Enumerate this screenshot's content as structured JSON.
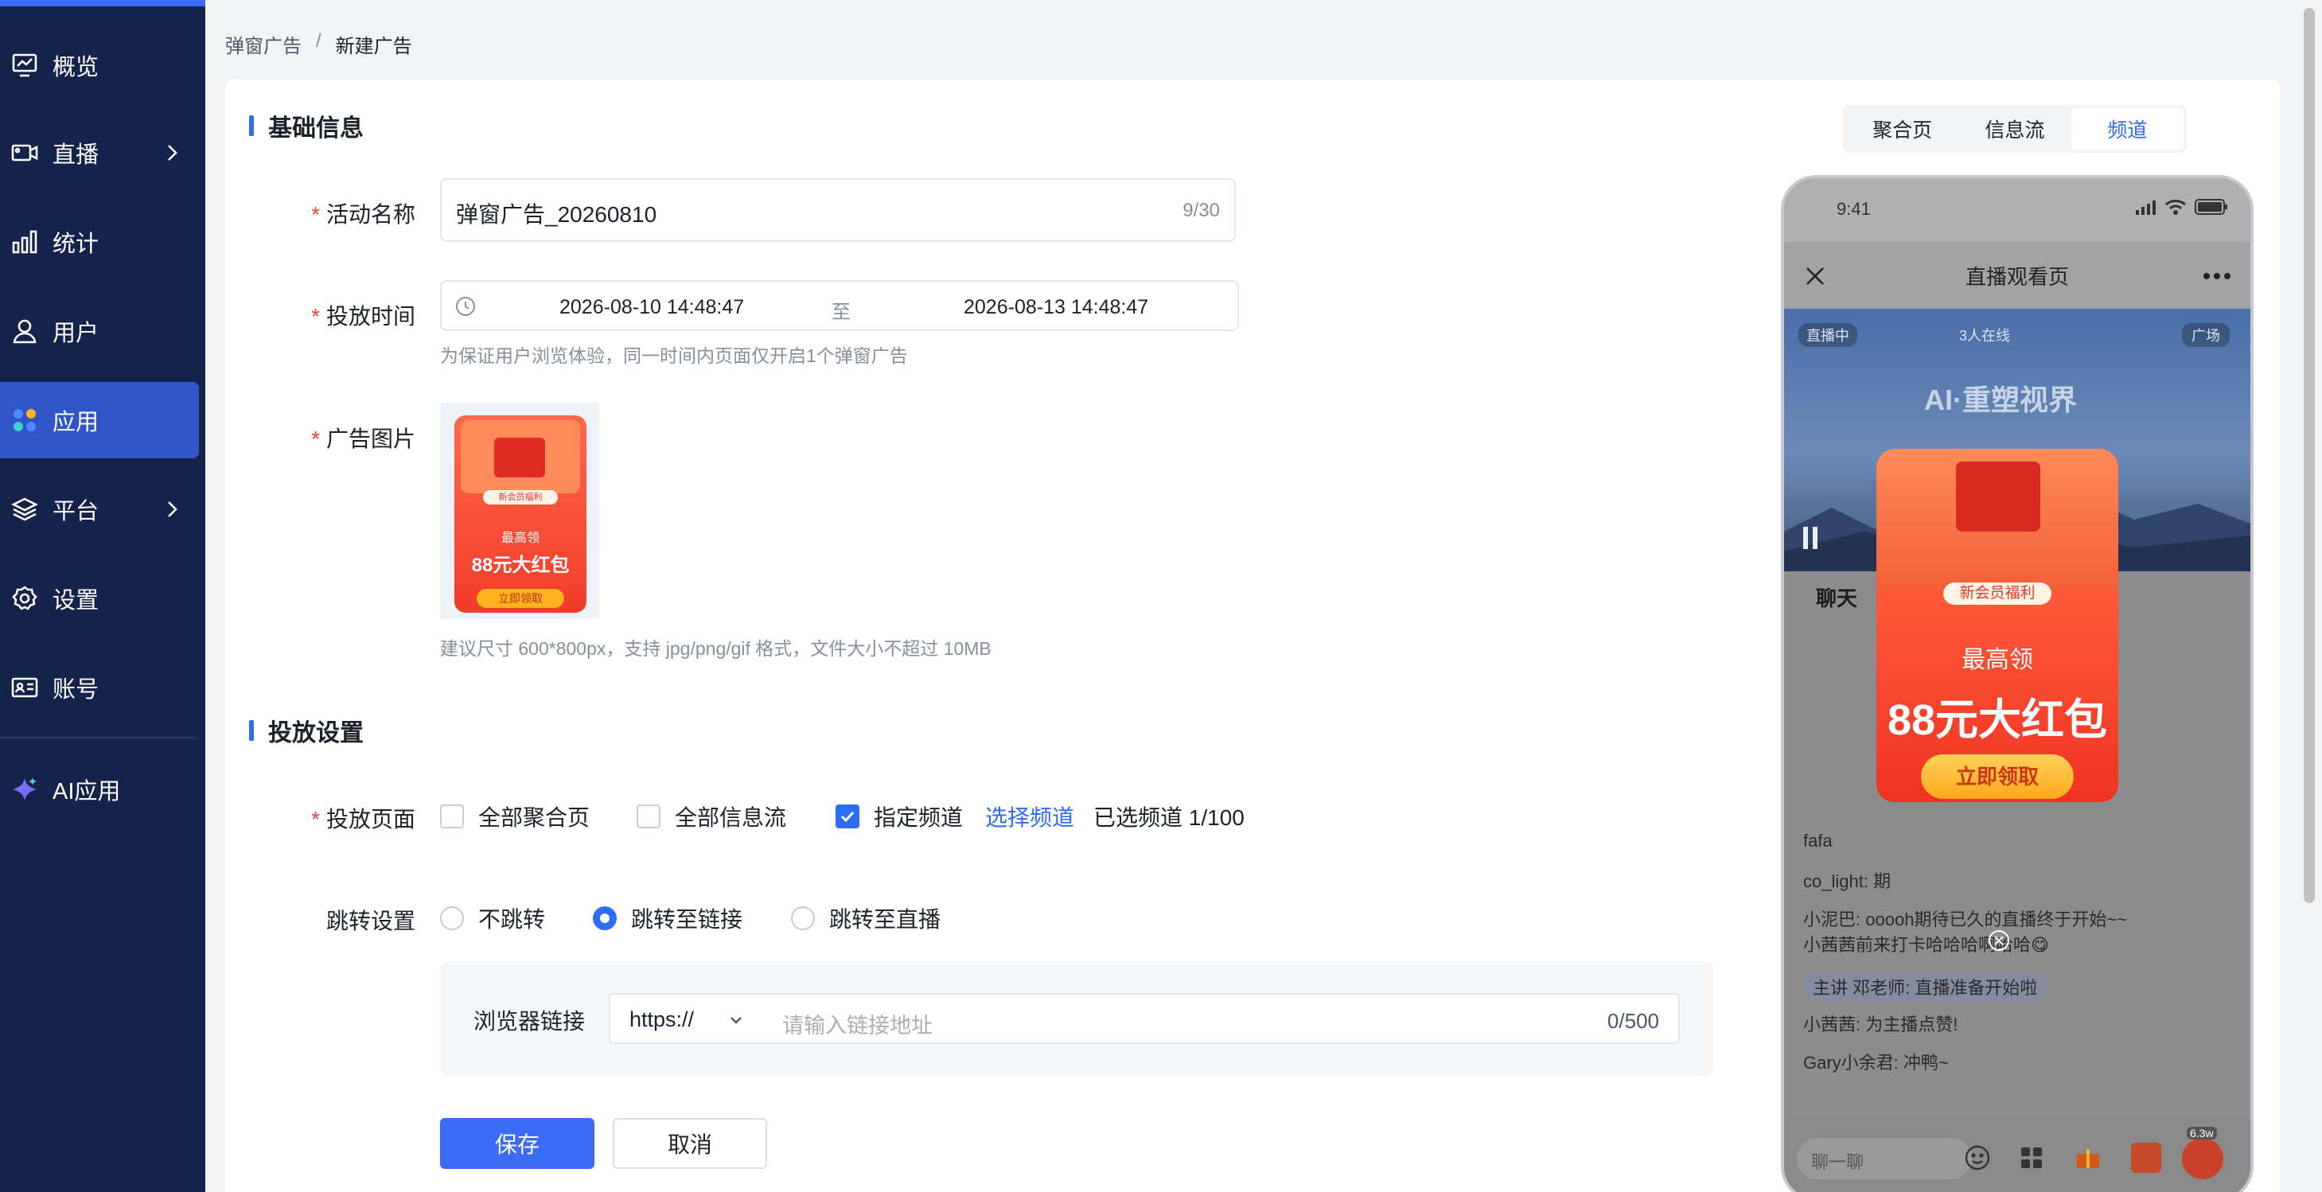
{
  "sidebar": {
    "items": [
      {
        "label": "概览",
        "icon": "monitor-chart-icon"
      },
      {
        "label": "直播",
        "icon": "video-camera-icon"
      },
      {
        "label": "统计",
        "icon": "bar-chart-icon"
      },
      {
        "label": "用户",
        "icon": "user-icon"
      },
      {
        "label": "应用",
        "icon": "apps-grid-icon"
      },
      {
        "label": "平台",
        "icon": "layers-icon"
      },
      {
        "label": "设置",
        "icon": "gear-icon"
      },
      {
        "label": "账号",
        "icon": "id-card-icon"
      },
      {
        "label": "AI应用",
        "icon": "ai-sparkle-icon"
      }
    ],
    "active": "应用",
    "accent": "#2f55c8"
  },
  "breadcrumb": {
    "parent": "弹窗广告",
    "sep": "/",
    "current": "新建广告"
  },
  "basic": {
    "title": "基础信息",
    "name_label": "活动名称",
    "name_value": "弹窗广告_20260810",
    "name_count": "9/30",
    "time_label": "投放时间",
    "start": "2026-08-10 14:48:47",
    "to": "至",
    "end": "2026-08-13 14:48:47",
    "time_hint": "为保证用户浏览体验，同一时间内页面仅开启1个弹窗广告",
    "image_label": "广告图片",
    "image_hint": "建议尺寸 600*800px，支持 jpg/png/gif 格式，文件大小不超过 10MB",
    "thumb_badge": "新会员福利",
    "thumb_top": "最高领",
    "thumb_main": "88元大红包",
    "thumb_btn": "立即领取"
  },
  "delivery": {
    "title": "投放设置",
    "page_label": "投放页面",
    "opt_all_agg": "全部聚合页",
    "opt_all_feed": "全部信息流",
    "opt_channel": "指定频道",
    "choose_channel": "选择频道",
    "selected_count": "已选频道 1/100",
    "jump_label": "跳转设置",
    "jump_none": "不跳转",
    "jump_link": "跳转至链接",
    "jump_live": "跳转至直播",
    "browser_label": "浏览器链接",
    "protocol": "https://",
    "url_placeholder": "请输入链接地址",
    "url_count": "0/500"
  },
  "actions": {
    "save": "保存",
    "cancel": "取消"
  },
  "preview": {
    "tabs": [
      "聚合页",
      "信息流",
      "频道"
    ],
    "selected_tab": "频道",
    "time": "9:41",
    "page_title": "直播观看页",
    "live_tag": "直播中",
    "online": "3人在线",
    "square": "广场",
    "banner": "AI·重塑视界",
    "chat_tab": "聊天",
    "popup_badge": "新会员福利",
    "popup_top": "最高领",
    "popup_main": "88元大红包",
    "popup_btn": "立即领取",
    "chats": [
      {
        "name": "fafa",
        "text": ""
      },
      {
        "name": "co_light:",
        "text": "期"
      },
      {
        "name": "小泥巴:",
        "text": "ooooh期待已久的直播终于开始~~"
      },
      {
        "name": "",
        "text": "小茜茜前来打卡哈哈哈啊哈哈😋"
      },
      {
        "name": "主讲 邓老师:",
        "text": "直播准备开始啦"
      },
      {
        "name": "小茜茜:",
        "text": "为主播点赞!"
      },
      {
        "name": "Gary小余君:",
        "text": "冲鸭~"
      }
    ],
    "input_placeholder": "聊一聊",
    "like_count": "6.3w"
  }
}
